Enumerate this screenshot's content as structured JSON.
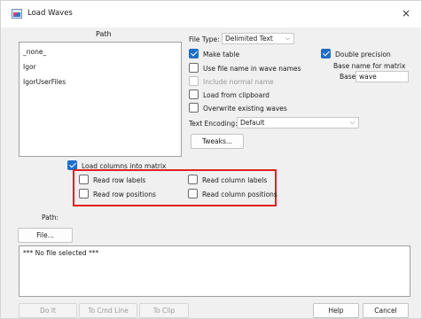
{
  "window": {
    "title": "Load Waves",
    "close_glyph": "×"
  },
  "path": {
    "header": "Path",
    "items": [
      "_none_",
      "Igor",
      "IgorUserFiles"
    ],
    "field_label": "Path:",
    "file_button": "File..."
  },
  "options": {
    "file_type_label": "File Type:",
    "file_type_value": "Delimited Text",
    "make_table": "Make table",
    "use_file_name": "Use file name in wave names",
    "include_normal_name": "Include normal name",
    "load_from_clipboard": "Load from clipboard",
    "overwrite_existing": "Overwrite existing waves",
    "text_encoding_label": "Text Encoding:",
    "text_encoding_value": "Default",
    "tweaks_button": "Tweaks...",
    "double_precision": "Double precision",
    "base_name_header": "Base name for matrix",
    "base_label": "Base:",
    "base_value": "wave"
  },
  "matrix": {
    "load_columns": "Load columns into matrix",
    "read_row_labels": "Read row labels",
    "read_row_positions": "Read row positions",
    "read_column_labels": "Read column labels",
    "read_column_positions": "Read column positions"
  },
  "status": {
    "text": "*** No file selected ***"
  },
  "buttons": {
    "do_it": "Do It",
    "to_cmd_line": "To Cmd Line",
    "to_clip": "To Clip",
    "help": "Help",
    "cancel": "Cancel"
  },
  "colors": {
    "accent": "#1f6fc5",
    "highlight": "#e02020"
  }
}
